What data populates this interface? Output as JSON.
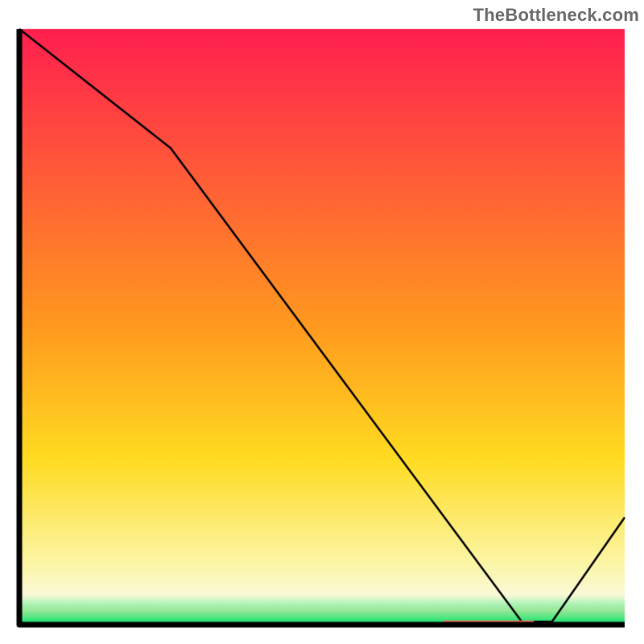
{
  "brand": "TheBottleneck.com",
  "colors": {
    "top": "#ff1f4f",
    "mid": "#ffdb20",
    "yellow_light": "#fff7c3",
    "green": "#00e56a",
    "axis": "#000000",
    "line": "#000000",
    "bar": "#ee6a60"
  },
  "chart_data": {
    "type": "line",
    "title": "",
    "xlabel": "",
    "ylabel": "",
    "xlim": [
      0,
      100
    ],
    "ylim": [
      0,
      100
    ],
    "x": [
      0,
      25,
      83,
      88,
      100
    ],
    "y": [
      100,
      80,
      0.5,
      0.5,
      18
    ],
    "bar": {
      "x0": 70,
      "x1": 85,
      "y": 0.7
    }
  }
}
